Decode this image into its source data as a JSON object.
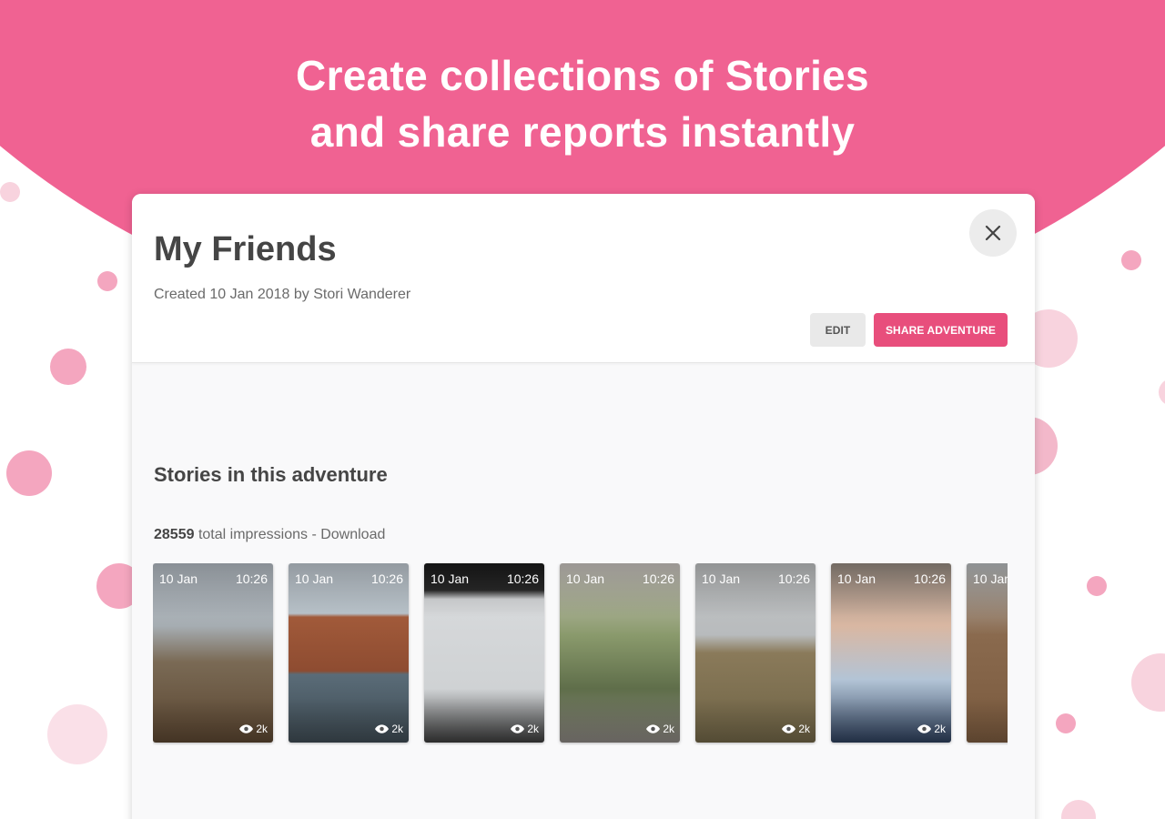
{
  "headline": {
    "line1": "Create collections of Stories",
    "line2": "and share reports instantly"
  },
  "adventure": {
    "title": "My Friends",
    "subtitle": "Created 10 Jan 2018 by Stori Wanderer",
    "edit_label": "EDIT",
    "share_label": "SHARE ADVENTURE"
  },
  "stories_section": {
    "title": "Stories in this adventure",
    "impressions_count": "28559",
    "impressions_text": "total impressions - Download"
  },
  "stories": [
    {
      "date": "10 Jan",
      "time": "10:26",
      "views": "2k"
    },
    {
      "date": "10 Jan",
      "time": "10:26",
      "views": "2k"
    },
    {
      "date": "10 Jan",
      "time": "10:26",
      "views": "2k"
    },
    {
      "date": "10 Jan",
      "time": "10:26",
      "views": "2k"
    },
    {
      "date": "10 Jan",
      "time": "10:26",
      "views": "2k"
    },
    {
      "date": "10 Jan",
      "time": "10:26",
      "views": "2k"
    },
    {
      "date": "10 Jan",
      "time": "",
      "views": ""
    }
  ],
  "colors": {
    "brand_pink": "#f06292",
    "share_button": "#e84e7c"
  }
}
